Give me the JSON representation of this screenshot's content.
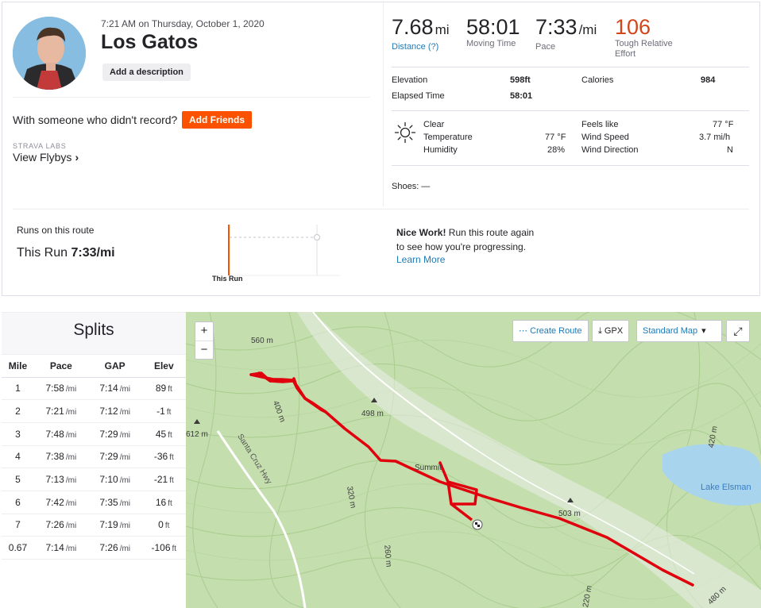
{
  "athlete": {
    "date": "7:21 AM on Thursday, October 1, 2020",
    "title": "Los Gatos",
    "add_description": "Add a description",
    "with_someone": "With someone who didn't record?",
    "add_friends": "Add Friends",
    "labs_label": "STRAVA LABS",
    "flybys": "View Flybys",
    "flybys_chevron": "›"
  },
  "stats": {
    "distance": {
      "value": "7.68",
      "unit": "mi",
      "label": "Distance (?)"
    },
    "moving_time": {
      "value": "58:01",
      "label": "Moving Time"
    },
    "pace": {
      "value": "7:33",
      "unit": "/mi",
      "label": "Pace"
    },
    "effort": {
      "value": "106",
      "label1": "Tough Relative",
      "label2": "Effort"
    },
    "elevation_label": "Elevation",
    "elevation_value": "598ft",
    "calories_label": "Calories",
    "calories_value": "984",
    "elapsed_label": "Elapsed Time",
    "elapsed_value": "58:01"
  },
  "weather": {
    "condition": "Clear",
    "temperature_label": "Temperature",
    "temperature_value": "77 °F",
    "humidity_label": "Humidity",
    "humidity_value": "28%",
    "feels_like_label": "Feels like",
    "feels_like_value": "77 °F",
    "wind_speed_label": "Wind Speed",
    "wind_speed_value": "3.7 mi/h",
    "wind_direction_label": "Wind Direction",
    "wind_direction_value": "N"
  },
  "shoes": "Shoes: —",
  "route": {
    "title": "Runs on this route",
    "this_run_prefix": "This Run",
    "this_run_pace": "7:33/mi",
    "tick_label": "This Run",
    "nice_work_bold": "Nice Work!",
    "nice_work_text1": " Run this route again",
    "nice_work_text2": "to see how you're progressing.",
    "learn_more": "Learn More"
  },
  "splits": {
    "title": "Splits",
    "headers": [
      "Mile",
      "Pace",
      "GAP",
      "Elev"
    ],
    "rows": [
      {
        "mile": "1",
        "pace": "7:58",
        "gap": "7:14",
        "elev": "89"
      },
      {
        "mile": "2",
        "pace": "7:21",
        "gap": "7:12",
        "elev": "-1"
      },
      {
        "mile": "3",
        "pace": "7:48",
        "gap": "7:29",
        "elev": "45"
      },
      {
        "mile": "4",
        "pace": "7:38",
        "gap": "7:29",
        "elev": "-36"
      },
      {
        "mile": "5",
        "pace": "7:13",
        "gap": "7:10",
        "elev": "-21"
      },
      {
        "mile": "6",
        "pace": "7:42",
        "gap": "7:35",
        "elev": "16"
      },
      {
        "mile": "7",
        "pace": "7:26",
        "gap": "7:19",
        "elev": "0"
      },
      {
        "mile": "0.67",
        "pace": "7:14",
        "gap": "7:26",
        "elev": "-106"
      }
    ],
    "pace_unit": "/mi",
    "elev_unit": "ft"
  },
  "map": {
    "zoom_in": "+",
    "zoom_out": "−",
    "create_route": "Create Route",
    "gpx": "GPX",
    "map_style": "Standard Map",
    "labels": {
      "m560": "560 m",
      "m400": "400 m",
      "m612": "612 m",
      "m498": "498 m",
      "hwy": "Santa Cruz Hwy",
      "summit": "Summit",
      "m320": "320 m",
      "m503": "503 m",
      "m260": "260 m",
      "m420": "420 m",
      "lake": "Lake Elsman",
      "m480": "480 m",
      "m220": "220 m"
    },
    "route_color": "#e0000d"
  }
}
